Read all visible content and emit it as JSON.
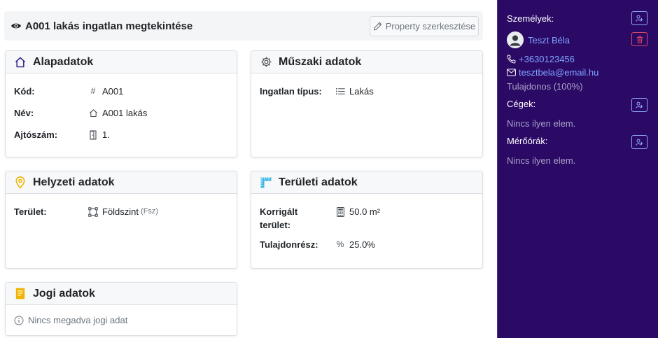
{
  "page": {
    "title": "A001 lakás ingatlan megtekintése",
    "edit_button": "Property szerkesztése"
  },
  "cards": {
    "alap": {
      "title": "Alapadatok",
      "rows": [
        {
          "label": "Kód:",
          "value": "A001"
        },
        {
          "label": "Név:",
          "value": "A001 lakás"
        },
        {
          "label": "Ajtószám:",
          "value": "1."
        }
      ]
    },
    "muszaki": {
      "title": "Műszaki adatok",
      "rows": [
        {
          "label": "Ingatlan típus:",
          "value": "Lakás"
        }
      ]
    },
    "helyzeti": {
      "title": "Helyzeti adatok",
      "rows": [
        {
          "label": "Terület:",
          "value": "Földszint",
          "sub": "(Fsz)"
        }
      ]
    },
    "teruleti": {
      "title": "Területi adatok",
      "rows": [
        {
          "label_line1": "Korrigált",
          "label_line2": "terület:",
          "value": "50.0 m²"
        },
        {
          "label": "Tulajdonrész:",
          "value": "25.0%"
        }
      ]
    },
    "jogi": {
      "title": "Jogi adatok",
      "empty": "Nincs megadva jogi adat"
    }
  },
  "sidebar": {
    "persons_label": "Személyek:",
    "person_name": "Teszt Béla",
    "phone": "+3630123456",
    "email": "tesztbela@email.hu",
    "role": "Tulajdonos (100%)",
    "companies_label": "Cégek:",
    "companies_empty": "Nincs ilyen elem.",
    "meters_label": "Mérőórák:",
    "meters_empty": "Nincs ilyen elem."
  },
  "colors": {
    "sidebar_bg": "#2b0a66",
    "link": "#7ea4ff",
    "danger": "#e04a5f",
    "location_icon": "#f0b400",
    "legal_icon": "#f0b400",
    "area_icon": "#3fb8e6"
  },
  "icons": {
    "title": "eye-icon",
    "edit": "pencil-icon",
    "alap": "house-icon",
    "muszaki": "gear-icon",
    "helyzeti": "map-pin-icon",
    "teruleti": "ruler-icon",
    "jogi": "document-icon"
  }
}
